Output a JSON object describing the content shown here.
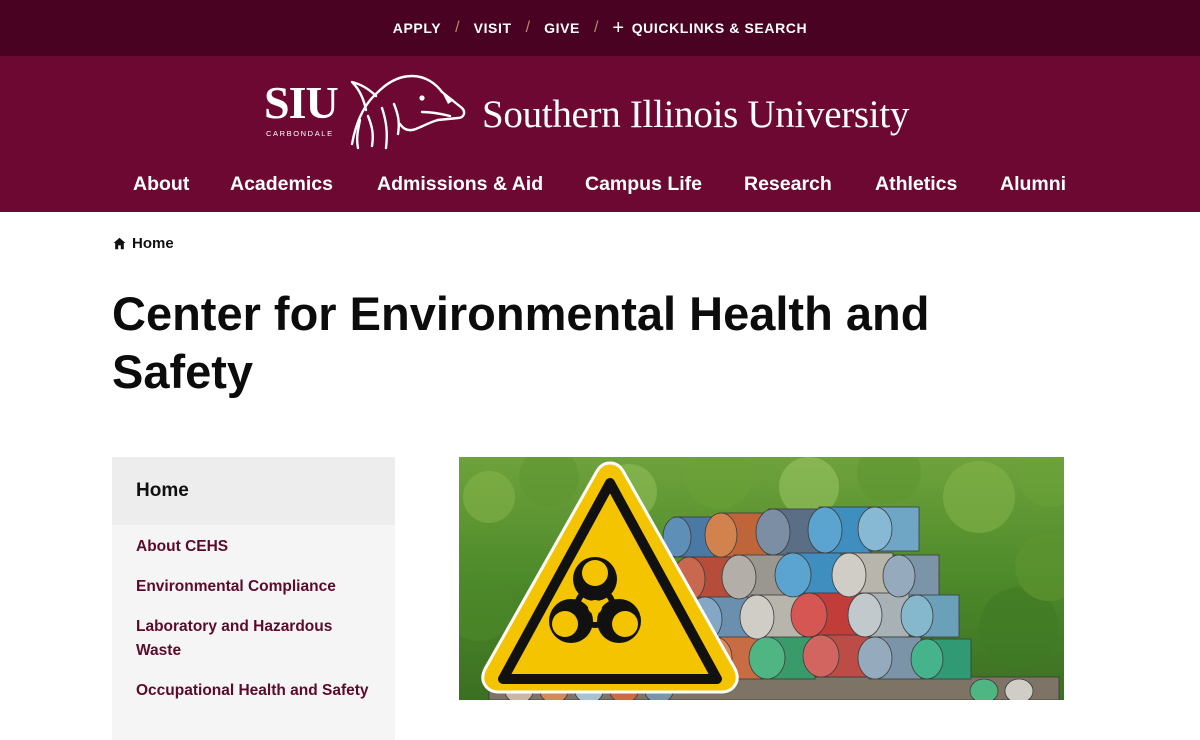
{
  "utility": {
    "links": [
      {
        "label": "APPLY"
      },
      {
        "label": "VISIT"
      },
      {
        "label": "GIVE"
      }
    ],
    "quicklinks_label": "QUICKLINKS & SEARCH",
    "separator": "/"
  },
  "brand": {
    "logo_letters": "SIU",
    "logo_subtext": "CARBONDALE",
    "university_name": "Southern Illinois University"
  },
  "nav": {
    "items": [
      {
        "label": "About"
      },
      {
        "label": "Academics"
      },
      {
        "label": "Admissions & Aid"
      },
      {
        "label": "Campus Life"
      },
      {
        "label": "Research"
      },
      {
        "label": "Athletics"
      },
      {
        "label": "Alumni"
      }
    ]
  },
  "breadcrumb": {
    "home_label": "Home",
    "icon": "home-icon"
  },
  "page": {
    "title": "Center for Environmental Health and Safety"
  },
  "sidebar": {
    "heading": "Home",
    "items": [
      {
        "label": "About CEHS"
      },
      {
        "label": "Environmental Compliance"
      },
      {
        "label": "Laboratory and Hazardous Waste"
      },
      {
        "label": "Occupational Health and Safety"
      }
    ]
  },
  "hero": {
    "icon": "biohazard-icon"
  },
  "colors": {
    "utility_bg": "#4a0223",
    "header_bg": "#6d0833",
    "sidebar_link": "#5c0a2b",
    "hazard_yellow": "#f5c400"
  }
}
